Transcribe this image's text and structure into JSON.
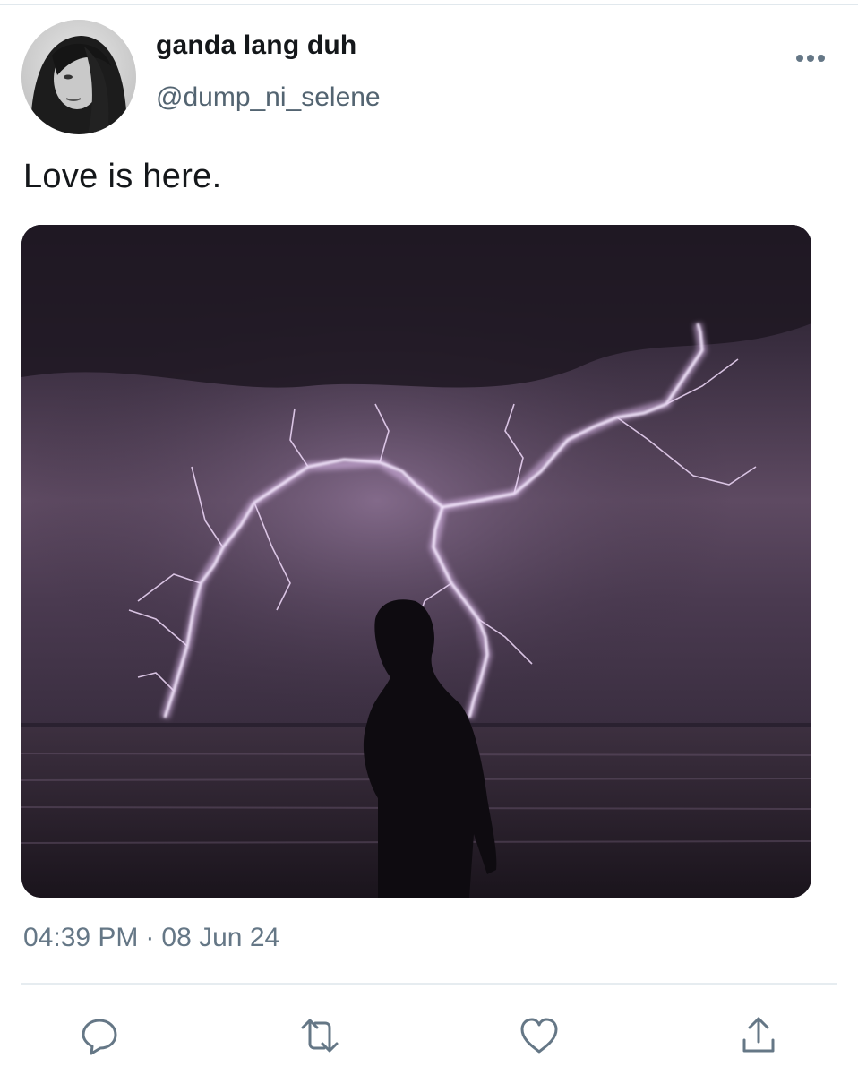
{
  "user": {
    "display_name": "ganda lang duh",
    "handle": "@dump_ni_selene",
    "avatar_icon": "avatar-photo"
  },
  "tweet": {
    "text": "Love is here.",
    "time": "04:39 PM",
    "separator": "·",
    "date": "08 Jun 24"
  },
  "icons": {
    "more": "more-horizontal-icon",
    "reply": "reply-icon",
    "retweet": "retweet-icon",
    "like": "like-icon",
    "share": "share-icon"
  },
  "colors": {
    "text_primary": "#14171a",
    "text_secondary": "#657786",
    "icon": "#657786",
    "divider": "#e6ecf0"
  }
}
